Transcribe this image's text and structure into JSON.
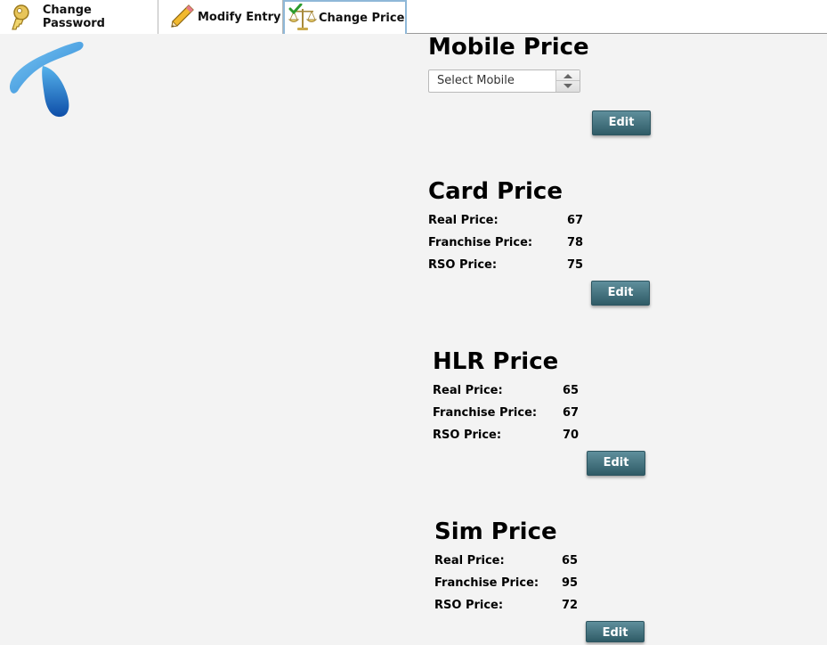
{
  "tabs": [
    {
      "label": "Change Password",
      "icon": "key-icon"
    },
    {
      "label": "Modify Entry",
      "icon": "pencil-icon"
    },
    {
      "label": "Change Price",
      "icon": "scale-check-icon",
      "active": true
    }
  ],
  "logo": {
    "icon": "brand-logo-icon",
    "color": "#1e73c8"
  },
  "mobile_price": {
    "title": "Mobile Price",
    "select_value": "Select Mobile",
    "edit_label": "Edit"
  },
  "card_price": {
    "title": "Card Price",
    "rows": [
      {
        "label": "Real Price:",
        "value": "67"
      },
      {
        "label": "Franchise Price:",
        "value": "78"
      },
      {
        "label": "RSO Price:",
        "value": "75"
      }
    ],
    "edit_label": "Edit"
  },
  "hlr_price": {
    "title": "HLR Price",
    "rows": [
      {
        "label": "Real Price:",
        "value": "65"
      },
      {
        "label": "Franchise Price:",
        "value": "67"
      },
      {
        "label": "RSO Price:",
        "value": "70"
      }
    ],
    "edit_label": "Edit"
  },
  "sim_price": {
    "title": "Sim Price",
    "rows": [
      {
        "label": "Real Price:",
        "value": "65"
      },
      {
        "label": "Franchise Price:",
        "value": "95"
      },
      {
        "label": "RSO Price:",
        "value": "72"
      }
    ],
    "edit_label": "Edit"
  },
  "colors": {
    "button": "#3d6b76",
    "tab_active_border": "#8fb8d8",
    "background": "#f3f3f3"
  }
}
